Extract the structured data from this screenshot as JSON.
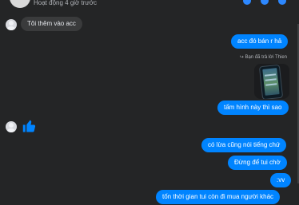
{
  "header": {
    "status": "Hoạt động 4 giờ trước"
  },
  "messages": {
    "m1": "Tôi thêm vào acc",
    "m2": "acc đó bán r hả",
    "reply_note": "Bạn đã trả lời Thien",
    "m3": "tấm hình này thì sao",
    "m4": "có lừa cũng nói tiếng chứ",
    "m5": "Đừng để tui chờ",
    "m6": ":vv",
    "m7": "tốn thời gian tui còn đi mua người khác"
  },
  "icons": {
    "like": "like-thumb-icon",
    "reply": "reply-arrow-icon"
  },
  "colors": {
    "background": "#242526",
    "incoming": "#3a3b3c",
    "outgoing": "#0084ff"
  }
}
